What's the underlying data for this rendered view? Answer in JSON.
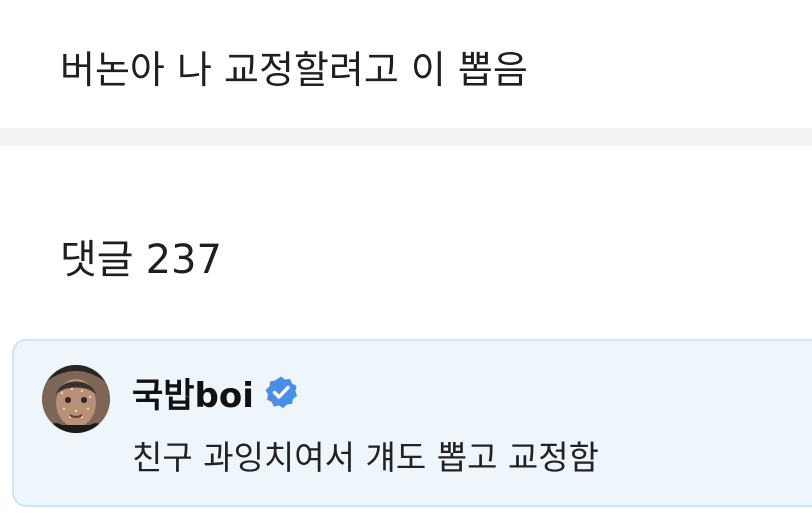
{
  "post": {
    "text": "버논아 나 교정할려고 이 뽑음"
  },
  "comments": {
    "label": "댓글",
    "count": "237",
    "items": [
      {
        "author": "국밥boi",
        "verified": true,
        "text": "친구 과잉치여서 걔도 뽑고 교정함"
      }
    ]
  },
  "colors": {
    "card_bg": "#eef6fc",
    "card_border": "#cfe4f4",
    "verified_badge": "#4a8fe7",
    "divider_band": "#f2f3f5"
  },
  "icons": {
    "verified": "verified-badge-icon",
    "avatar": "user-avatar-image"
  }
}
